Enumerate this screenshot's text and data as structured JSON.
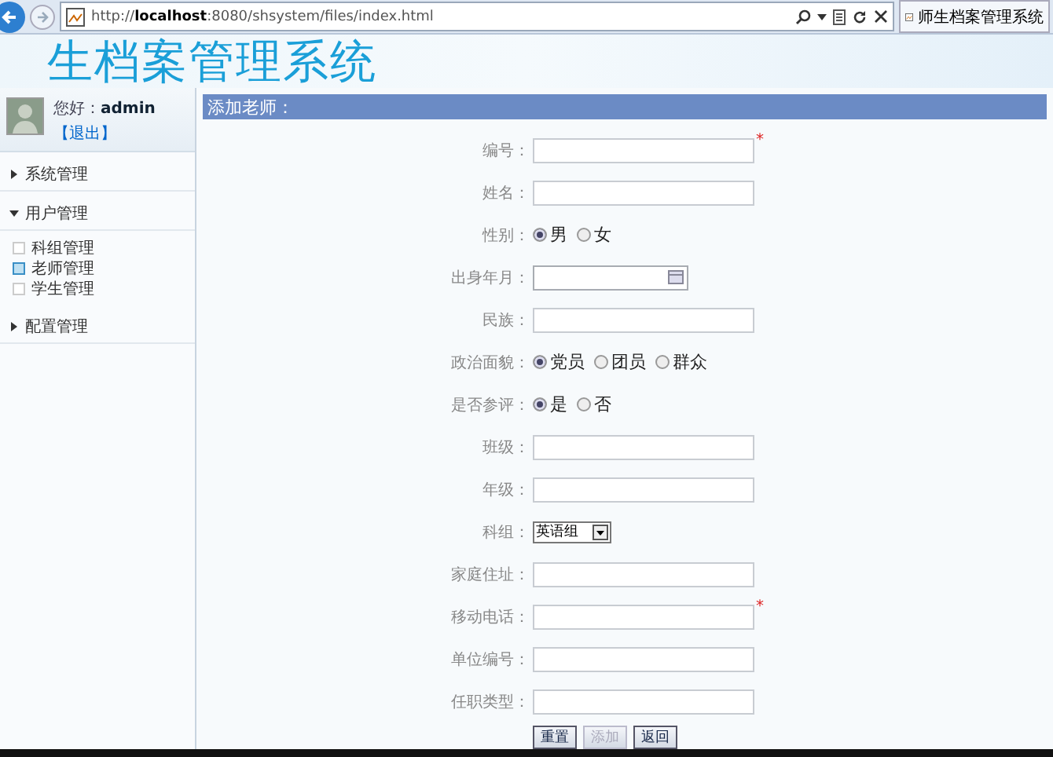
{
  "browser": {
    "address": "http://**localhost**:8080/shsystem/files/index.html",
    "tab_title": "师生档案管理系统"
  },
  "banner": {
    "title": "生档案管理系统"
  },
  "user": {
    "greeting": "您好：",
    "name": "admin",
    "logout": "【退出】"
  },
  "sidebar": {
    "items": [
      {
        "label": "系统管理",
        "expanded": false
      },
      {
        "label": "用户管理",
        "expanded": true,
        "children": [
          {
            "label": "科组管理",
            "selected": false
          },
          {
            "label": "老师管理",
            "selected": true
          },
          {
            "label": "学生管理",
            "selected": false
          }
        ]
      },
      {
        "label": "配置管理",
        "expanded": false
      }
    ]
  },
  "form": {
    "title": "添加老师：",
    "fields": [
      {
        "label": "编号：",
        "kind": "text",
        "required_mark": "*"
      },
      {
        "label": "姓名：",
        "kind": "text"
      },
      {
        "label": "性别：",
        "kind": "radio",
        "options": [
          {
            "label": "男",
            "selected": true
          },
          {
            "label": "女",
            "selected": false
          }
        ]
      },
      {
        "label": "出身年月：",
        "kind": "date"
      },
      {
        "label": "民族：",
        "kind": "text"
      },
      {
        "label": "政治面貌：",
        "kind": "radio",
        "options": [
          {
            "label": "党员",
            "selected": true
          },
          {
            "label": "团员",
            "selected": false
          },
          {
            "label": "群众",
            "selected": false
          }
        ]
      },
      {
        "label": "是否参评：",
        "kind": "radio",
        "options": [
          {
            "label": "是",
            "selected": true
          },
          {
            "label": "否",
            "selected": false
          }
        ]
      },
      {
        "label": "班级：",
        "kind": "text"
      },
      {
        "label": "年级：",
        "kind": "text"
      },
      {
        "label": "科组：",
        "kind": "select",
        "value": "英语组"
      },
      {
        "label": "家庭住址：",
        "kind": "text"
      },
      {
        "label": "移动电话：",
        "kind": "text",
        "required_mark": "*"
      },
      {
        "label": "单位编号：",
        "kind": "text"
      },
      {
        "label": "任职类型：",
        "kind": "text"
      }
    ],
    "buttons": [
      {
        "label": "重置",
        "disabled": false
      },
      {
        "label": "添加",
        "disabled": true
      },
      {
        "label": "返回",
        "disabled": false
      }
    ]
  }
}
